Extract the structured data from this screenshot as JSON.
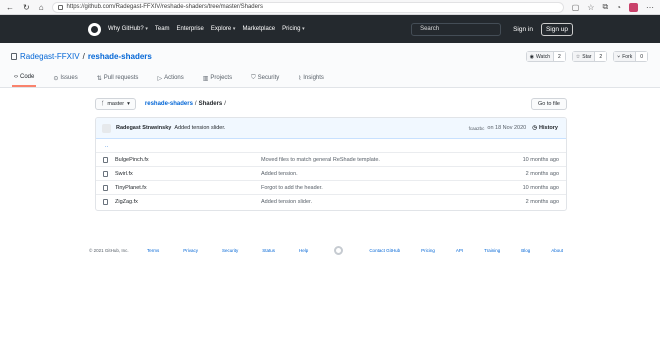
{
  "browser": {
    "url": "https://github.com/Radegast-FFXIV/reshade-shaders/tree/master/Shaders"
  },
  "header": {
    "nav": [
      "Why GitHub?",
      "Team",
      "Enterprise",
      "Explore",
      "Marketplace",
      "Pricing"
    ],
    "search_placeholder": "Search",
    "signin": "Sign in",
    "signup": "Sign up"
  },
  "repo": {
    "owner": "Radegast-FFXIV",
    "separator": "/",
    "name": "reshade-shaders",
    "watch_label": "Watch",
    "watch_count": "2",
    "star_label": "Star",
    "star_count": "2",
    "fork_label": "Fork",
    "fork_count": "0",
    "tabs": [
      {
        "label": "Code",
        "icon": "code-icon"
      },
      {
        "label": "Issues",
        "icon": "issue-icon"
      },
      {
        "label": "Pull requests",
        "icon": "pull-request-icon"
      },
      {
        "label": "Actions",
        "icon": "play-icon"
      },
      {
        "label": "Projects",
        "icon": "project-icon"
      },
      {
        "label": "Security",
        "icon": "shield-icon"
      },
      {
        "label": "Insights",
        "icon": "graph-icon"
      }
    ]
  },
  "filenav": {
    "branch": "master",
    "crumb_repo": "reshade-shaders",
    "crumb_sep": "/",
    "crumb_dir": "Shaders",
    "crumb_tail": "/",
    "goto_file": "Go to file"
  },
  "commit": {
    "author": "Radegast Strawinsky",
    "message": "Added tension slider.",
    "hash": "fcaa2bc",
    "date": "on 18 Nov 2020",
    "history": "History"
  },
  "updir": "..",
  "files": [
    {
      "name": "BulgePinch.fx",
      "message": "Moved files to match general ReShade template.",
      "age": "10 months ago"
    },
    {
      "name": "Swirl.fx",
      "message": "Added tension.",
      "age": "2 months ago"
    },
    {
      "name": "TinyPlanet.fx",
      "message": "Forgot to add the header.",
      "age": "10 months ago"
    },
    {
      "name": "ZigZag.fx",
      "message": "Added tension slider.",
      "age": "2 months ago"
    }
  ],
  "footer": {
    "copyright": "© 2021 GitHub, Inc.",
    "left_links": [
      "Terms",
      "Privacy",
      "Security",
      "Status",
      "Help"
    ],
    "right_links": [
      "Contact GitHub",
      "Pricing",
      "API",
      "Training",
      "Blog",
      "About"
    ]
  },
  "colors": {
    "header_bg": "#24292e",
    "link": "#0366d6",
    "tab_underline": "#f9826c",
    "commit_bg": "#f1f8ff"
  }
}
